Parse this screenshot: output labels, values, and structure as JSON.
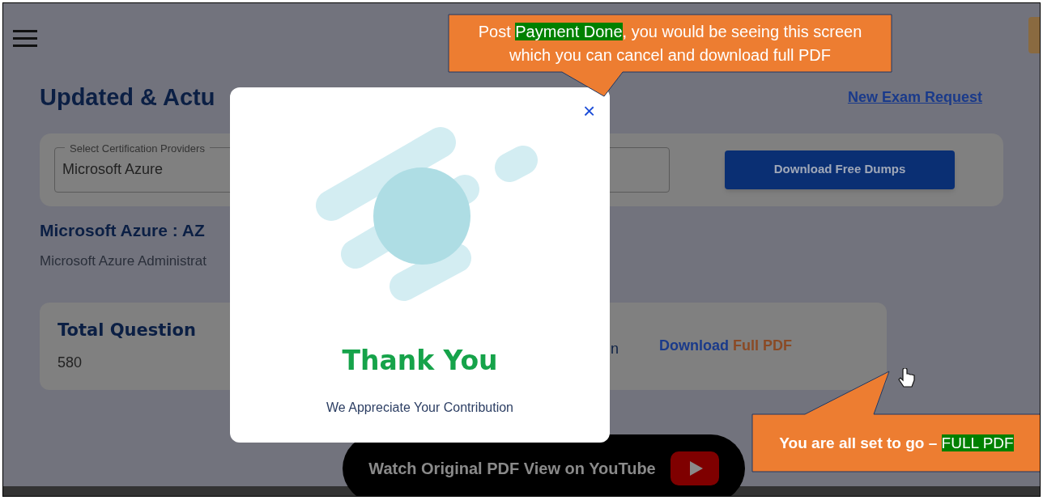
{
  "page": {
    "title": "Updated & Actu",
    "new_exam_link": "New Exam Request"
  },
  "provider_select": {
    "label": "Select Certification Providers",
    "value": "Microsoft Azure"
  },
  "download_free_button": "Download Free Dumps",
  "exam": {
    "heading": "Microsoft Azure : AZ",
    "subheading": "Microsoft Azure Administrat"
  },
  "stats": [
    {
      "kind": "stat",
      "label": "Total Question",
      "value": "580"
    },
    {
      "kind": "partial",
      "text": "n"
    },
    {
      "kind": "download",
      "prefix": "Download",
      "suffix": "Full PDF"
    }
  ],
  "youtube_button": "Watch Original PDF View on YouTube",
  "modal": {
    "title": "Thank You",
    "message": "We Appreciate Your Contribution",
    "close": "×"
  },
  "callouts": [
    {
      "kind": "top",
      "segments": [
        {
          "text": "Post ",
          "highlight": false
        },
        {
          "text": "Payment Done",
          "highlight": true
        },
        {
          "text": ", you would be seeing this screen which you can cancel and download full PDF",
          "highlight": false
        }
      ]
    },
    {
      "kind": "bottom",
      "segments": [
        {
          "text": "You are all set to go – ",
          "highlight": false
        },
        {
          "text": "FULL PDF",
          "highlight": true
        }
      ]
    }
  ]
}
